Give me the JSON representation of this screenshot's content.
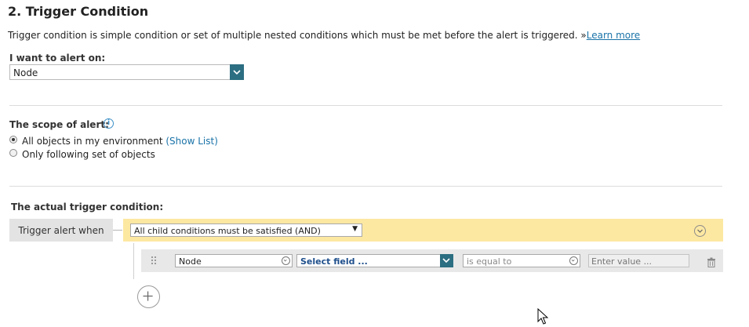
{
  "section": {
    "title": "2. Trigger Condition",
    "description": "Trigger condition is simple condition or set of multiple nested conditions which must be met before the alert is triggered.",
    "learn_more_prefix": "»",
    "learn_more_label": "Learn more"
  },
  "alert_on": {
    "label": "I want to alert on:",
    "selected": "Node"
  },
  "scope": {
    "label": "The scope of alert:",
    "info_icon": "info-icon",
    "options": [
      {
        "label": "All objects in my environment",
        "link": "(Show List)",
        "selected": true
      },
      {
        "label": "Only following set of objects",
        "selected": false
      }
    ]
  },
  "trigger": {
    "label": "The actual trigger condition:",
    "when_label": "Trigger alert when",
    "group_condition": "All child conditions must be satisfied (AND)",
    "row": {
      "object": "Node",
      "field": "Select field ...",
      "operator": "is equal to",
      "value_placeholder": "Enter value ..."
    },
    "colors": {
      "group_bar": "#fde8a2",
      "row_bar": "#e8e8e8",
      "accent": "#2c6e82",
      "link": "#1a73a8"
    }
  }
}
